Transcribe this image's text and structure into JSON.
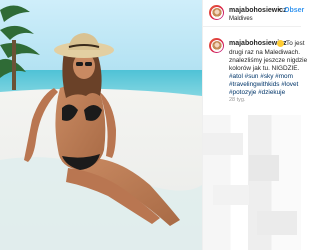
{
  "post": {
    "username": "majabohosiewicz",
    "location": "Maldives",
    "follow_text": "Obser",
    "caption_lines": [
      "To jest",
      "drugi raz na Malediwach.",
      "znalezliśmy jeszcze nigdzie",
      "kolorów jak tu. NIGDZIE."
    ],
    "hashtag_lines": [
      "#atol #sun #sky #mom",
      "#travelingwithkids #lovet",
      "#potozyje #dziekuje"
    ],
    "time_ago": "28 tyg."
  },
  "colors": {
    "link_blue": "#3897f0",
    "hashtag_blue": "#003569",
    "text": "#262626",
    "muted": "#999999"
  }
}
